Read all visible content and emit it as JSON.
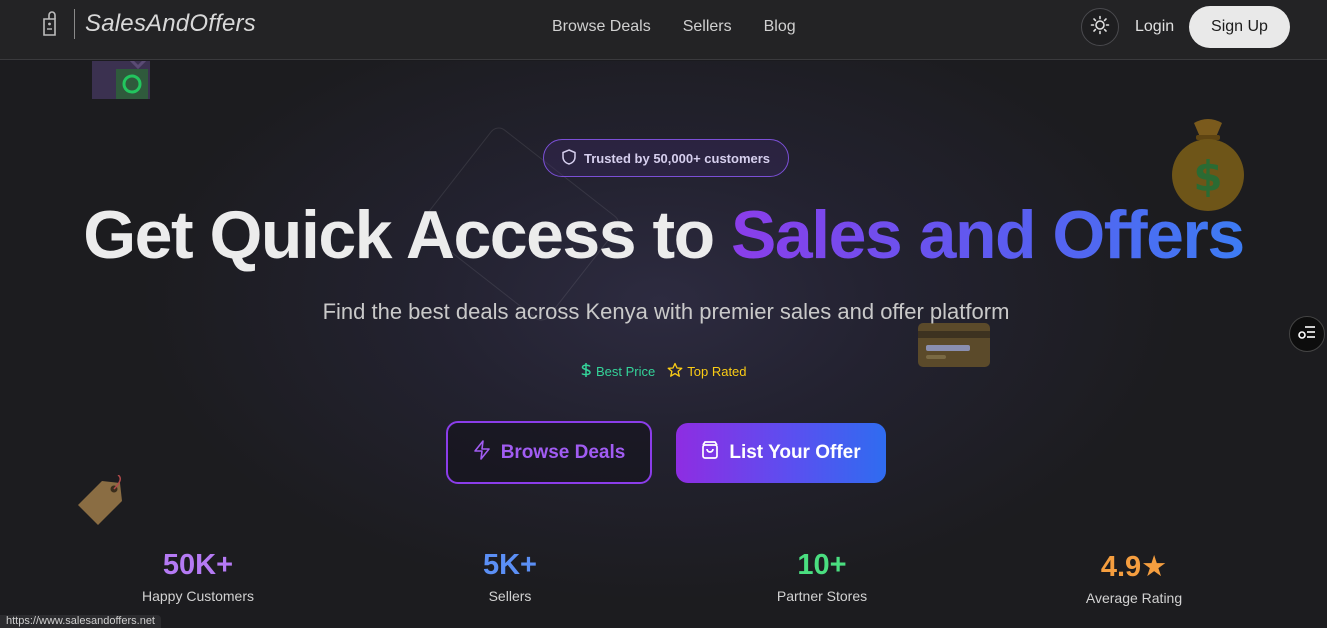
{
  "header": {
    "logo_text": "SalesAndOffers",
    "nav": [
      {
        "label": "Browse Deals"
      },
      {
        "label": "Sellers"
      },
      {
        "label": "Blog"
      }
    ],
    "theme_icon": "sun-icon",
    "login_label": "Login",
    "signup_label": "Sign Up"
  },
  "hero": {
    "badge_text": "Trusted by 50,000+ customers",
    "badge_icon": "shield-icon",
    "headline_plain": "Get Quick Access to ",
    "headline_accent": "Sales and Offers",
    "subtitle": "Find the best deals across Kenya with premier sales and offer platform",
    "features": [
      {
        "label": "Best Price",
        "icon": "dollar-icon",
        "color": "#34d399"
      },
      {
        "label": "Top Rated",
        "icon": "star-icon",
        "color": "#facc15"
      }
    ],
    "browse_button": "Browse Deals",
    "list_button": "List Your Offer"
  },
  "stats": [
    {
      "value": "50K+",
      "label": "Happy Customers",
      "color": "#b57af4"
    },
    {
      "value": "5K+",
      "label": "Sellers",
      "color": "#5b8ff5"
    },
    {
      "value": "10+",
      "label": "Partner Stores",
      "color": "#4ade80"
    },
    {
      "value": "4.9★",
      "label": "Average Rating",
      "color": "#f59e3f"
    }
  ],
  "status_url": "https://www.salesandoffers.net",
  "colors": {
    "accent_purple": "#8b3dea",
    "accent_blue": "#3d7cf3",
    "background": "#1b1b1f"
  }
}
